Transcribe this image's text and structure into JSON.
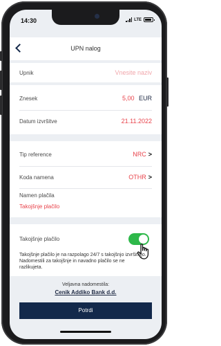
{
  "status": {
    "time": "14:30",
    "network": "LTE"
  },
  "header": {
    "title": "UPN nalog"
  },
  "fields": {
    "upnik": {
      "label": "Upnik",
      "placeholder": "Vnesite naziv"
    },
    "znesek": {
      "label": "Znesek",
      "amount": "5,00",
      "currency": "EUR"
    },
    "datum": {
      "label": "Datum izvršitve",
      "value": "21.11.2022"
    },
    "tip_reference": {
      "label": "Tip reference",
      "value": "NRC",
      "chevron": ">"
    },
    "koda_namena": {
      "label": "Koda namena",
      "value": "OTHR",
      "chevron": ">"
    },
    "namen": {
      "label": "Namen plačila",
      "value": "Takojšnje plačilo"
    }
  },
  "instant": {
    "label": "Takojšnje plačilo",
    "toggle_on": true,
    "info": "Takojšnje plačilo je na razpolago 24/7 s takojšnjo izvršitvijo. Nadomestili za takojšnje in navadno plačilo se ne razlikujeta."
  },
  "fees": {
    "label": "Veljavna nadomestila:",
    "link": "Cenik Addiko Bank d.d."
  },
  "actions": {
    "confirm": "Potrdi"
  },
  "colors": {
    "accent_red": "#e8424a",
    "navy": "#13294b",
    "toggle_green": "#2eb84a"
  },
  "icons": {
    "back": "chevron-left-icon",
    "pointer": "hand-pointer-icon"
  }
}
